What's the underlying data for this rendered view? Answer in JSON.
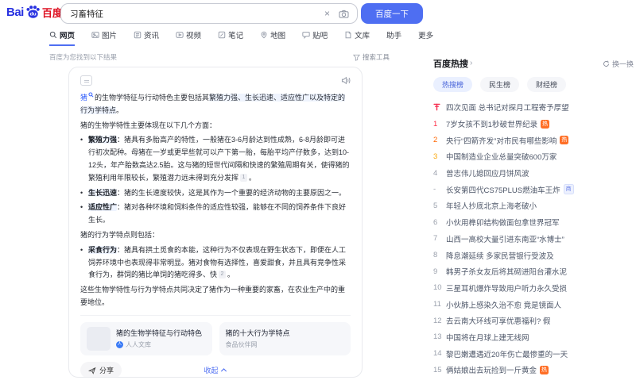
{
  "colors": {
    "accent": "#4e6ef2",
    "logo_blue": "#2932e1",
    "logo_red": "#de1021",
    "link_blue": "#315efb",
    "rank1": "#fe2d46",
    "rank2": "#ff6600",
    "rank3": "#faa90e",
    "hot_badge": "#ff6f26"
  },
  "brand": {
    "latin": "Bai",
    "paw_text": "du",
    "cn": "百度"
  },
  "search": {
    "query": "习畜特征",
    "submit": "百度一下"
  },
  "nav": {
    "tabs": [
      {
        "label": "网页",
        "icon": "search",
        "active": true
      },
      {
        "label": "图片",
        "icon": "image",
        "active": false
      },
      {
        "label": "资讯",
        "icon": "news",
        "active": false
      },
      {
        "label": "视频",
        "icon": "video",
        "active": false
      },
      {
        "label": "笔记",
        "icon": "note",
        "active": false
      },
      {
        "label": "地图",
        "icon": "map",
        "active": false
      },
      {
        "label": "贴吧",
        "icon": "tieba",
        "active": false
      },
      {
        "label": "文库",
        "icon": "doc",
        "active": false
      }
    ],
    "extras": [
      "助手",
      "更多"
    ]
  },
  "meta": {
    "result_info": "百度为您找到以下结果",
    "tools": "搜索工具"
  },
  "ai_summary": {
    "blocks": [
      {
        "type": "p",
        "segments": [
          {
            "text": "猪",
            "style": "entity"
          },
          {
            "text": "的生物学特征与行动特色主要包括其",
            "style": "normal"
          },
          {
            "text": "繁殖力强、生长迅速、适应性广以及特定的行为学特点",
            "style": "hl"
          },
          {
            "text": "。",
            "style": "normal"
          }
        ]
      },
      {
        "type": "p",
        "segments": [
          {
            "text": "猪的生物学特性主要体现在以下几个方面：",
            "style": "normal"
          }
        ]
      },
      {
        "type": "bullet",
        "segments": [
          {
            "text": "繁殖力强",
            "style": "lead"
          },
          {
            "text": "：猪具有多胎高产的特性，一般猪在3-6月龄达到性成熟，6-8月龄即可进行初次配种。母猪在一岁或更早些就可以产下第一胎，每胎平均产仔数多，达到10-12头，年产胎数高达2.5胎。这与猪的短世代间隔和快速的繁殖周期有关，使得猪的繁殖利用年限较长，繁殖潜力远未得到充分发挥",
            "style": "normal"
          },
          {
            "text": "1",
            "style": "cite"
          },
          {
            "text": "。",
            "style": "normal"
          }
        ]
      },
      {
        "type": "bullet",
        "segments": [
          {
            "text": "生长迅速",
            "style": "lead"
          },
          {
            "text": "：猪的生长速度较快，这是其作为一个重要的经济动物的主要原因之一。",
            "style": "normal"
          }
        ]
      },
      {
        "type": "bullet",
        "segments": [
          {
            "text": "适应性广",
            "style": "lead"
          },
          {
            "text": "：猪对各种环境和饲料条件的适应性较强，能够在不同的饲养条件下良好生长。",
            "style": "normal"
          }
        ]
      },
      {
        "type": "p",
        "segments": [
          {
            "text": "猪的行为学特点则包括：",
            "style": "normal"
          }
        ]
      },
      {
        "type": "bullet",
        "segments": [
          {
            "text": "采食行为",
            "style": "lead"
          },
          {
            "text": "：猪具有拱土觅食的本能，这种行为不仅表现在野生状态下，即便在人工饲养环境中也表现得非常明显。猪对食物有选择性，喜爱甜食，并且具有竞争性采食行为，群饲的猪比单饲的猪吃得多、快",
            "style": "normal"
          },
          {
            "text": "2",
            "style": "cite"
          },
          {
            "text": "。",
            "style": "normal"
          }
        ]
      },
      {
        "type": "p",
        "segments": [
          {
            "text": "这些生物学特性与行为学特点共同决定了猪作为一种重要的家畜，在农业生产中的重要地位。",
            "style": "normal"
          }
        ]
      }
    ],
    "sources": [
      {
        "title": "猪的生物学特征与行动特色",
        "site": "人人文库",
        "thumb": true,
        "site_icon": true
      },
      {
        "title": "猪的十大行为学特点",
        "site": "食品伙伴网",
        "thumb": false,
        "site_icon": false
      }
    ],
    "share": "分享",
    "collapse": "收起"
  },
  "hot_search": {
    "title": "百度热搜",
    "refresh": "换一换",
    "tabs": [
      {
        "label": "热搜榜",
        "active": true
      },
      {
        "label": "民生榜",
        "active": false
      },
      {
        "label": "财经榜",
        "active": false
      }
    ],
    "items": [
      {
        "rank": "pin",
        "text": "四次见面 总书记对探月工程寄予厚望"
      },
      {
        "rank": "1",
        "text": "7岁女孩不到1秒破世界纪录",
        "badge": "热"
      },
      {
        "rank": "2",
        "text": "央行“四箭齐发”对市民有哪些影响",
        "badge": "热"
      },
      {
        "rank": "3",
        "text": "中国制造业企业总量突破600万家"
      },
      {
        "rank": "4",
        "text": "曾志伟儿媳回应月饼风波"
      },
      {
        "rank": "-",
        "text": "长安第四代CS75PLUS燃油车王炸",
        "badge": "商"
      },
      {
        "rank": "5",
        "text": "年轻人抄底北京上海老破小"
      },
      {
        "rank": "6",
        "text": "小伙用榫卯结构做面包拿世界冠军"
      },
      {
        "rank": "7",
        "text": "山西一高校大量引进东南亚“水博士”"
      },
      {
        "rank": "8",
        "text": "降息潮延续 多家民营银行受波及"
      },
      {
        "rank": "9",
        "text": "韩男子杀女友后将其砌进阳台灌水泥"
      },
      {
        "rank": "10",
        "text": "三星耳机爆炸导致用户听力永久受损"
      },
      {
        "rank": "11",
        "text": "小伙肺上感染久治不愈 竟是镜面人"
      },
      {
        "rank": "12",
        "text": "去云南大环线可享优惠福利? 假"
      },
      {
        "rank": "13",
        "text": "中国将在月球上建无线网"
      },
      {
        "rank": "14",
        "text": "黎巴嫩遭遇近20年伤亡最惨重的一天"
      },
      {
        "rank": "15",
        "text": "俩姑娘出去玩捡到一斤黄金",
        "badge": "热"
      }
    ]
  }
}
